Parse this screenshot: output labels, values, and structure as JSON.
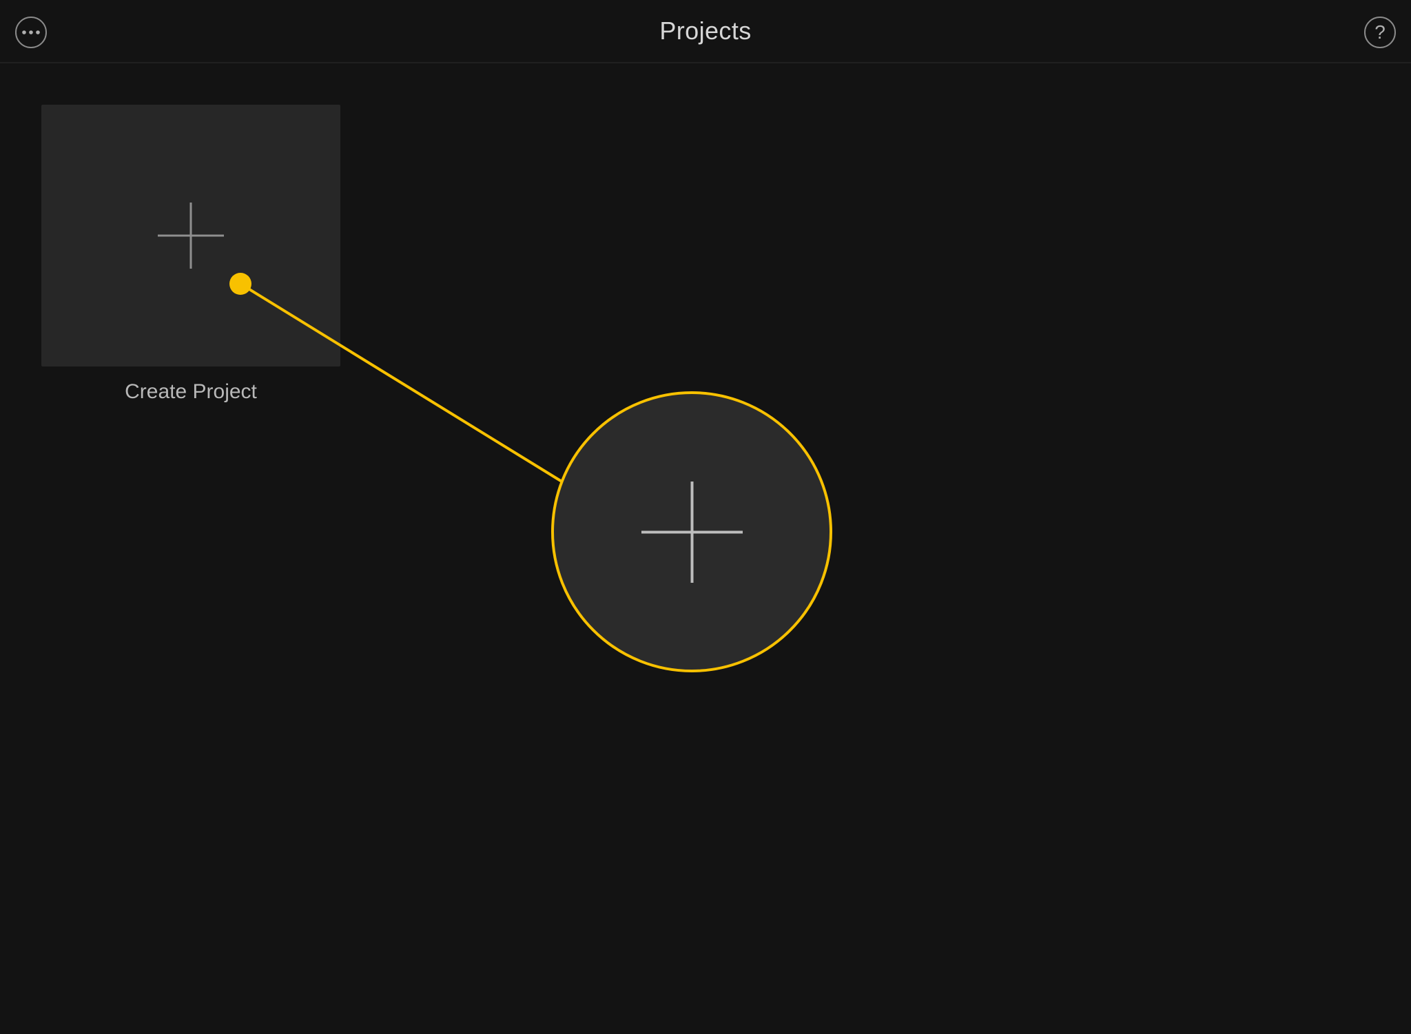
{
  "header": {
    "title": "Projects",
    "more_icon": "more-horizontal-icon",
    "help_label": "?"
  },
  "tiles": {
    "create": {
      "label": "Create Project",
      "icon": "plus-icon"
    }
  },
  "callout": {
    "icon": "plus-icon"
  },
  "colors": {
    "accent": "#f8c100",
    "bg": "#131313",
    "tile_bg": "#272727",
    "callout_bg": "#2b2b2b",
    "text": "#d6d6d6",
    "text_muted": "#b8b8b8",
    "stroke": "#8b8b8b"
  }
}
